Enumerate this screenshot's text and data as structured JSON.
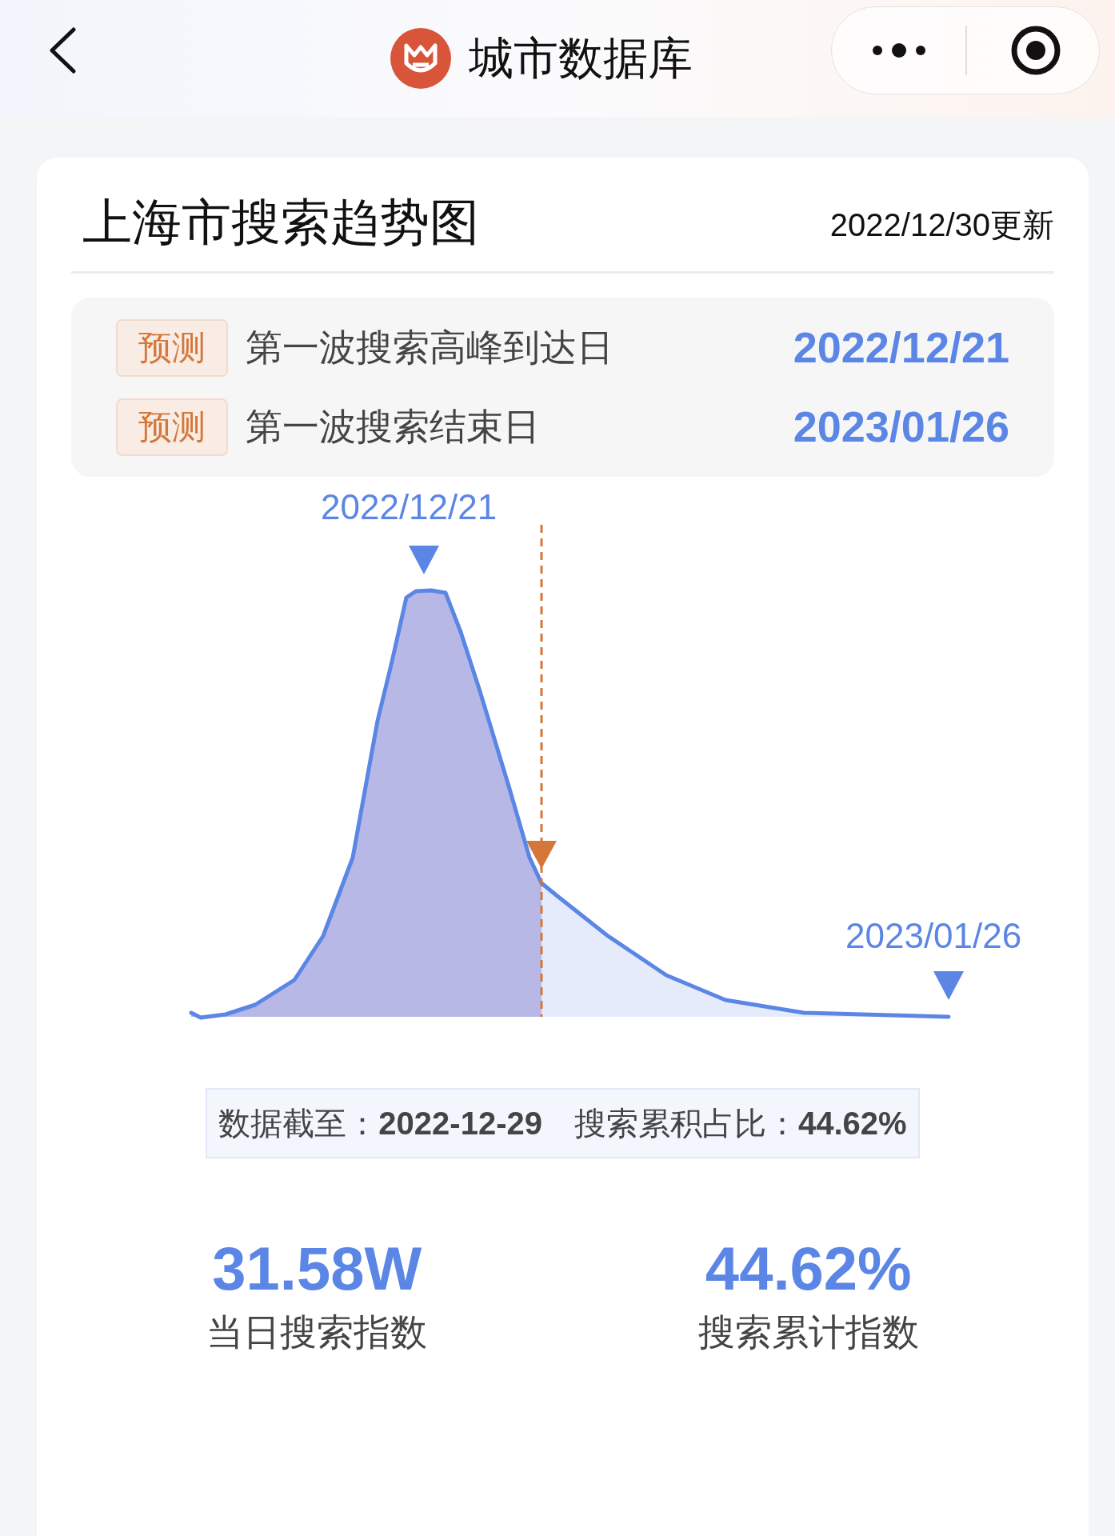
{
  "header": {
    "title": "城市数据库"
  },
  "card": {
    "title": "上海市搜索趋势图",
    "updated": "2022/12/30更新",
    "predictions": [
      {
        "badge": "预测",
        "label": "第一波搜索高峰到达日",
        "date": "2022/12/21"
      },
      {
        "badge": "预测",
        "label": "第一波搜索结束日",
        "date": "2023/01/26"
      }
    ],
    "chart": {
      "peak_label": "2022/12/21",
      "end_label": "2023/01/26"
    },
    "summary": "数据截至：**2022-12-29**　搜索累积占比：**44.62%**",
    "stats": [
      {
        "value": "31.58W",
        "label": "当日搜索指数"
      },
      {
        "value": "44.62%",
        "label": "搜索累计指数"
      }
    ]
  }
}
